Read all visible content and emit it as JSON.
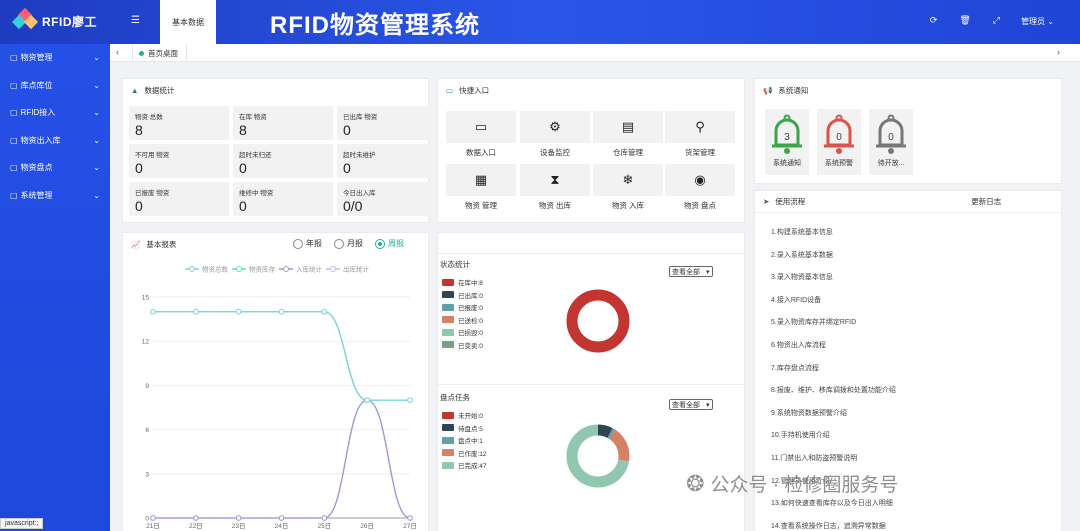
{
  "header": {
    "logo_text": "RFID廖工",
    "tab_label": "基本数据",
    "title": "RFID物资管理系统",
    "admin_label": "管理员"
  },
  "sidebar": {
    "items": [
      {
        "label": "物资管理"
      },
      {
        "label": "库点库位"
      },
      {
        "label": "RFID接入"
      },
      {
        "label": "物资出入库"
      },
      {
        "label": "物资盘点"
      },
      {
        "label": "系统管理"
      }
    ]
  },
  "tabs": {
    "home": "首页桌面"
  },
  "stats": {
    "title": "数据统计",
    "items": [
      {
        "label": "物资 总数",
        "value": "8"
      },
      {
        "label": "在库 物资",
        "value": "8"
      },
      {
        "label": "已出库 物资",
        "value": "0"
      },
      {
        "label": "不可用 物资",
        "value": "0"
      },
      {
        "label": "超时未归还",
        "value": "0"
      },
      {
        "label": "超时未维护",
        "value": "0"
      },
      {
        "label": "已报废 物资",
        "value": "0"
      },
      {
        "label": "维修中 物资",
        "value": "0"
      },
      {
        "label": "今日出入库",
        "value": "0/0"
      }
    ]
  },
  "quick": {
    "title": "快捷入口",
    "items": [
      {
        "label": "数据入口",
        "icon": "window-icon",
        "glyph": "▭"
      },
      {
        "label": "设备监控",
        "icon": "gears-icon",
        "glyph": "⚙"
      },
      {
        "label": "仓库管理",
        "icon": "document-icon",
        "glyph": "▤"
      },
      {
        "label": "货架管理",
        "icon": "search-icon",
        "glyph": "⚲"
      },
      {
        "label": "物资 管理",
        "icon": "calendar-icon",
        "glyph": "▦"
      },
      {
        "label": "物资 出库",
        "icon": "hourglass-icon",
        "glyph": "⧗"
      },
      {
        "label": "物资 入库",
        "icon": "snowflake-icon",
        "glyph": "❄"
      },
      {
        "label": "物资 盘点",
        "icon": "target-icon",
        "glyph": "◉"
      }
    ]
  },
  "notice": {
    "title": "系统通知",
    "bells": [
      {
        "label": "系统通知",
        "count": "3",
        "color": "#3aa648"
      },
      {
        "label": "系统预警",
        "count": "0",
        "color": "#d9534f"
      },
      {
        "label": "待开放...",
        "count": "0",
        "color": "#777777"
      }
    ]
  },
  "process": {
    "title": "使用流程",
    "update_log": "更新日志",
    "items": [
      "1.构建系统基本信息",
      "2.录入系统基本数据",
      "3.录入物资基本信息",
      "4.接入RFID设备",
      "5.录入物资库存并绑定RFID",
      "6.物资出入库流程",
      "7.库存盘点流程",
      "8.报废、维护、移库调拨和处置功能介绍",
      "9.系统物资数据预警介绍",
      "10.手持机使用介绍",
      "11.门禁出入和防盗预警说明",
      "12.管理员使用介绍",
      "13.如何快速查看库存以及今日出入明细",
      "14.查看系统操作日志，追溯异常数据"
    ]
  },
  "report": {
    "title": "基本报表",
    "options": [
      "年报",
      "月报",
      "周报"
    ],
    "selected": "周报"
  },
  "chart_data": {
    "type": "line",
    "title": "",
    "xlabel": "",
    "ylabel": "",
    "categories": [
      "21日",
      "22日",
      "23日",
      "24日",
      "25日",
      "26日",
      "27日"
    ],
    "ylim": [
      0,
      15
    ],
    "yticks": [
      0,
      3,
      6,
      9,
      12,
      15
    ],
    "legend_position": "top",
    "series": [
      {
        "name": "物资总数",
        "values": [
          14,
          14,
          14,
          14,
          14,
          8,
          8
        ],
        "color": "#7fd4d9"
      },
      {
        "name": "物资库存",
        "values": [
          14,
          14,
          14,
          14,
          14,
          8,
          8
        ],
        "color": "#5ee0b8"
      },
      {
        "name": "入库统计",
        "values": [
          0,
          0,
          0,
          0,
          0,
          8,
          0
        ],
        "color": "#9c98dc"
      },
      {
        "name": "出库统计",
        "values": [
          0,
          0,
          0,
          0,
          0,
          8,
          0
        ],
        "color": "#c7b8ef"
      }
    ]
  },
  "status": {
    "title": "状态统计",
    "select": "查看全部",
    "legend": [
      {
        "label": "在库中:8",
        "color": "#c23531"
      },
      {
        "label": "已出库:0",
        "color": "#2f4554"
      },
      {
        "label": "已报废:0",
        "color": "#61a0a8"
      },
      {
        "label": "已送检:0",
        "color": "#d48265"
      },
      {
        "label": "已损毁:0",
        "color": "#91c7ae"
      },
      {
        "label": "已变卖:0",
        "color": "#749f83"
      }
    ],
    "donut": [
      {
        "value": 8,
        "color": "#c23531"
      }
    ]
  },
  "inventory": {
    "title": "盘点任务",
    "select": "查看全部",
    "legend": [
      {
        "label": "未开始:0",
        "color": "#c23531"
      },
      {
        "label": "待盘点:5",
        "color": "#2f4554"
      },
      {
        "label": "盘点中:1",
        "color": "#61a0a8"
      },
      {
        "label": "已作废:12",
        "color": "#d48265"
      },
      {
        "label": "已完成:47",
        "color": "#91c7ae"
      }
    ],
    "donut": [
      {
        "value": 5,
        "color": "#2f4554"
      },
      {
        "value": 1,
        "color": "#61a0a8"
      },
      {
        "value": 12,
        "color": "#d48265"
      },
      {
        "value": 47,
        "color": "#91c7ae"
      }
    ]
  },
  "status_bar": "javascript:;",
  "watermark": "公众号 · 检修圈服务号"
}
